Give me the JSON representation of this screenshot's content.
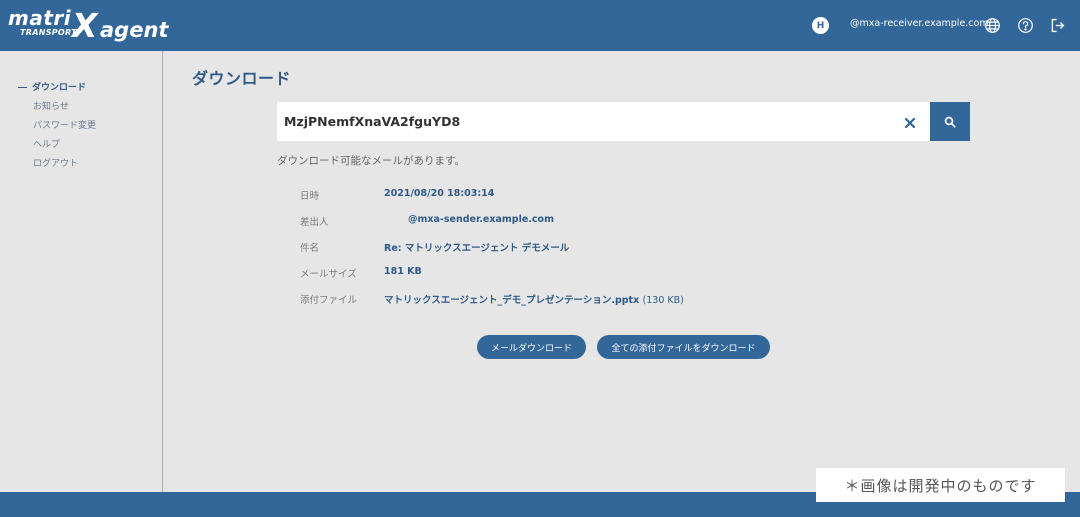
{
  "header": {
    "logo_matrix": "matri",
    "logo_transport": "TRANSPORT",
    "logo_x": "X",
    "logo_agent": "agent",
    "avatar_initial": "H",
    "user_email": "@mxa-receiver.example.com",
    "icons": [
      "globe-icon",
      "help-icon",
      "logout-icon"
    ],
    "brand_color": "#336699"
  },
  "sidebar": {
    "items": [
      {
        "label": "ダウンロード",
        "active": true
      },
      {
        "label": "お知らせ",
        "active": false
      },
      {
        "label": "パスワード変更",
        "active": false
      },
      {
        "label": "ヘルプ",
        "active": false
      },
      {
        "label": "ログアウト",
        "active": false
      }
    ]
  },
  "main": {
    "title": "ダウンロード",
    "search": {
      "value": "MzjPNemfXnaVA2fguYD8",
      "placeholder": ""
    },
    "message": "ダウンロード可能なメールがあります。",
    "details": {
      "date_label": "日時",
      "date_value": "2021/08/20 18:03:14",
      "sender_label": "差出人",
      "sender_value": "@mxa-sender.example.com",
      "subject_label": "件名",
      "subject_value": "Re: マトリックスエージェント デモメール",
      "size_label": "メールサイズ",
      "size_value": "181 KB",
      "attachment_label": "添付ファイル",
      "attachment_name": "マトリックスエージェント_デモ_プレゼンテーション.pptx",
      "attachment_size": "(130 KB)"
    },
    "buttons": {
      "mail_download": "メールダウンロード",
      "all_attachments": "全ての添付ファイルをダウンロード"
    }
  },
  "notice": "＊画像は開発中のものです"
}
